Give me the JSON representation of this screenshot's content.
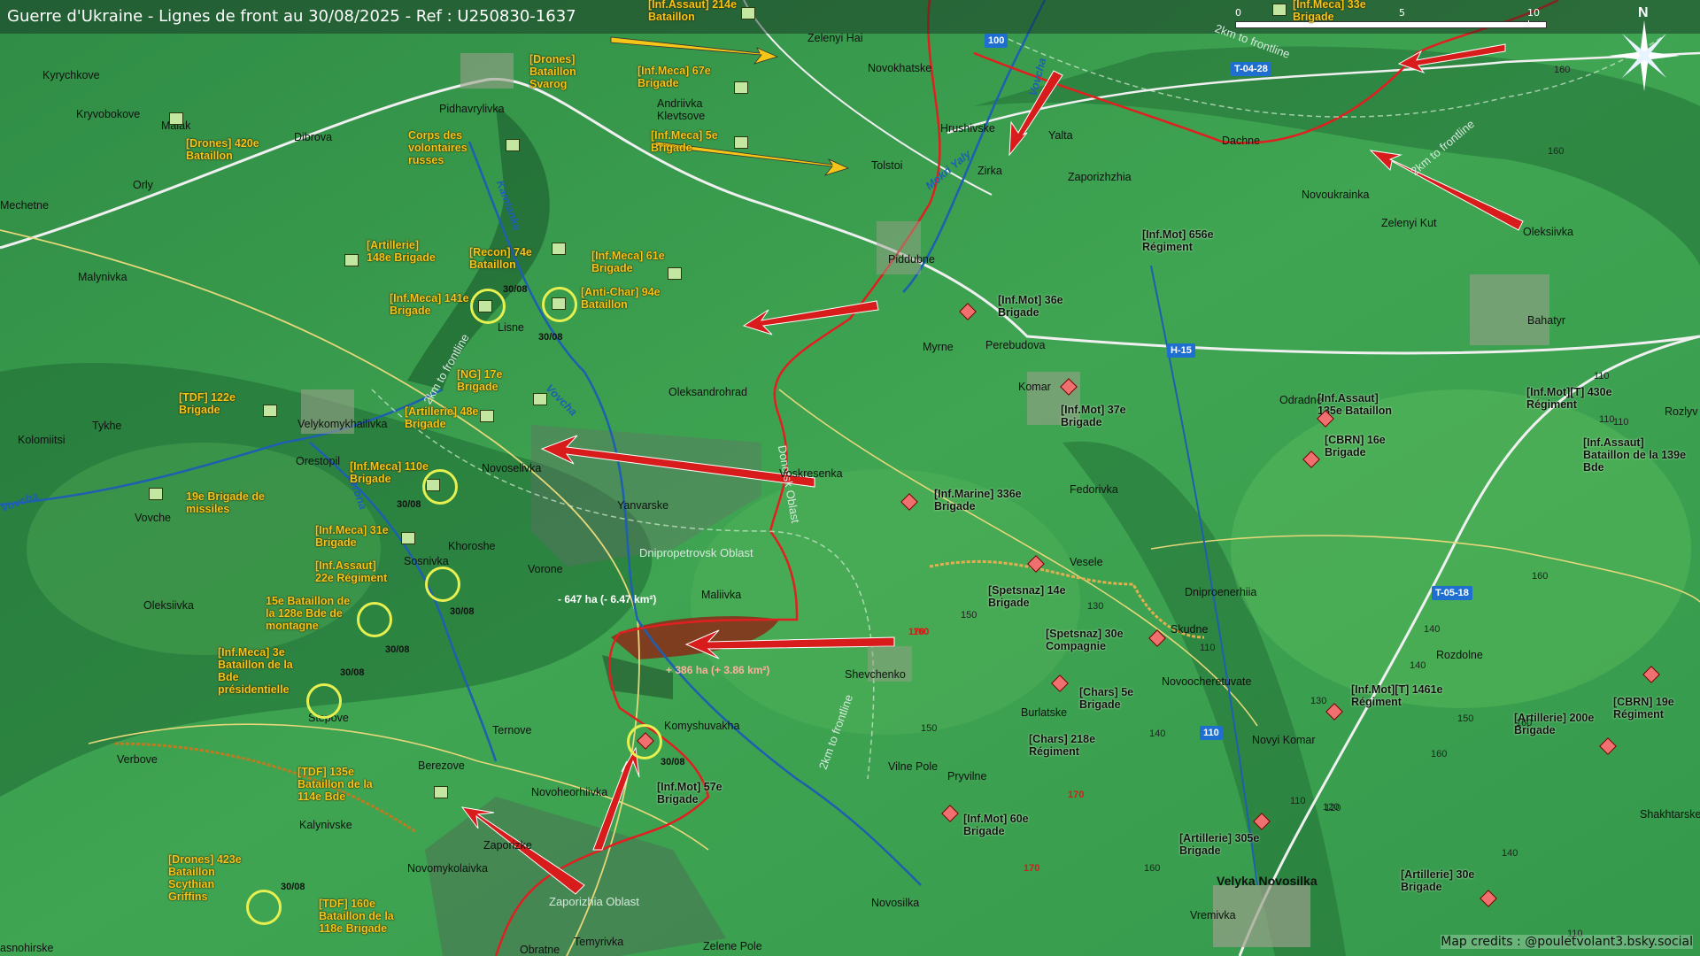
{
  "title": "Guerre d'Ukraine - Lignes de front au 30/08/2025 - Ref : U250830-1637",
  "colors": {
    "terrain_dark": "#1f6b34",
    "terrain_light": "#57b85c",
    "front_line": "#e02020",
    "ukraine_arrow": "#f5c518",
    "russia_arrow": "#d81c1c",
    "river": "#1e5fb0",
    "road_badge": "#1f6fd0",
    "gain_zone": "#8a2b16"
  },
  "scale": {
    "start": "0",
    "mid": "5",
    "end": "10 km"
  },
  "north_label": "N",
  "credits": "Map credits : @pouletvolant3.bsky.social",
  "changes": {
    "loss": "- 647 ha (- 6.47 km²)",
    "gain": "+ 386 ha (+ 3.86 km²)"
  },
  "roads": [
    "100",
    "T-04-28",
    "H-15",
    "T-05-18",
    "110"
  ],
  "oblasts": [
    "Dnipropetrovsk Oblast",
    "Donetsk Oblast",
    "Zaporizhia Oblast"
  ],
  "rivers": [
    "Vovcha",
    "Mokri Yaly",
    "Kamianka",
    "Vorona",
    "Vovcha",
    "Vovcha"
  ],
  "frontline_notes": [
    "2km to frontline",
    "2km to frontline",
    "2km to frontline",
    "2km to frontline"
  ],
  "towns": [
    "Kyrychkove",
    "Kryvobokove",
    "Maiak",
    "Dibrova",
    "Pidhavrylivka",
    "Andriivka Klevtsove",
    "Mechetne",
    "Orly",
    "Malynivka",
    "Zelenyi Hai",
    "Novokhatske",
    "Hrushivske",
    "Yalta",
    "Tolstoi",
    "Zirka",
    "Zaporizhzhia",
    "Dachne",
    "Novoukrainka",
    "Zelenyi Kut",
    "Oleksiivka",
    "Piddubne",
    "Myrne",
    "Perebudova",
    "Komar",
    "Bahatyr",
    "Lisne",
    "Oleksandrohrad",
    "Velykomykhailivka",
    "Tykhe",
    "Kolomiitsi",
    "Orestopil",
    "Voskresenka",
    "Novoselivka",
    "Yanvarske",
    "Vovche",
    "Khoroshe",
    "Sosnivka",
    "Vorone",
    "Maliivka",
    "Oleksiivka",
    "Odradne",
    "Rozlyv",
    "Fedorivka",
    "Vesele",
    "Dniproenerhiia",
    "Skudne",
    "Novoocheretuvate",
    "Rozdolne",
    "Shevchenko",
    "Burlatske",
    "Novyi Komar",
    "Stepove",
    "Ternove",
    "Komyshuvakha",
    "Verbove",
    "Berezove",
    "Vilne Pole",
    "Pryvilne",
    "Novoheorhiivka",
    "Kalynivske",
    "Zaporizke",
    "Novomykolaivka",
    "Novosilka",
    "Vremivka",
    "Velyka Novosilka",
    "Shakhtarske",
    "Temyrivka",
    "Obratne",
    "Zelene Pole",
    "asnohirske"
  ],
  "ua_units": [
    "[Inf.Assaut] 214e Bataillon",
    "[Inf.Meca] 33e Brigade",
    "[Drones] Bataillon Svarog",
    "[Inf.Meca] 67e Brigade",
    "[Inf.Meca] 5e Brigade",
    "[Drones] 420e Bataillon",
    "Corps des volontaires russes",
    "[Artillerie] 148e Brigade",
    "[Recon] 74e Bataillon",
    "[Inf.Meca] 61e Brigade",
    "[Inf.Meca] 141e Brigade",
    "[Anti-Char] 94e Bataillon",
    "[TDF] 122e Brigade",
    "[NG] 17e Brigade",
    "[Artillerie] 48e Brigade",
    "[Inf.Meca] 110e Brigade",
    "19e Brigade de missiles",
    "[Inf.Meca] 31e Brigade",
    "[Inf.Assaut] 22e Régiment",
    "15e Bataillon de la 128e Bde de montagne",
    "[Inf.Meca] 3e Bataillon de la Bde présidentielle",
    "[TDF] 135e Bataillon de la 114e Bde",
    "[Drones] 423e Bataillon Scythian Griffins",
    "[TDF] 160e Bataillon de la 118e Brigade"
  ],
  "ru_units": [
    "[Inf.Mot] 656e Régiment",
    "[Inf.Mot] 36e Brigade",
    "[Inf.Mot] 37e Brigade",
    "[Inf.Assaut] 135e Bataillon",
    "[Inf.Mot][T] 430e Régiment",
    "[CBRN] 16e Brigade",
    "[Inf.Assaut] Bataillon de la 139e Bde",
    "[Inf.Marine] 336e Brigade",
    "[Spetsnaz] 14e Brigade",
    "[Spetsnaz] 30e Compagnie",
    "[Chars] 5e Brigade",
    "[Chars] 218e Régiment",
    "[Inf.Mot][T] 1461e Régiment",
    "[CBRN] 19e Régiment",
    "[Artillerie] 200e Brigade",
    "[Inf.Mot] 57e Brigade",
    "[Inf.Mot] 60e Brigade",
    "[Artillerie] 305e Brigade",
    "[Artillerie] 30e Brigade"
  ],
  "dates": "30/08",
  "altitudes": [
    "160",
    "160",
    "110",
    "110",
    "160",
    "160",
    "150",
    "140",
    "150",
    "130",
    "110",
    "140",
    "130",
    "120",
    "110",
    "170",
    "170",
    "160",
    "150",
    "140",
    "120",
    "170",
    "140",
    "110",
    "160",
    "160",
    "110"
  ]
}
